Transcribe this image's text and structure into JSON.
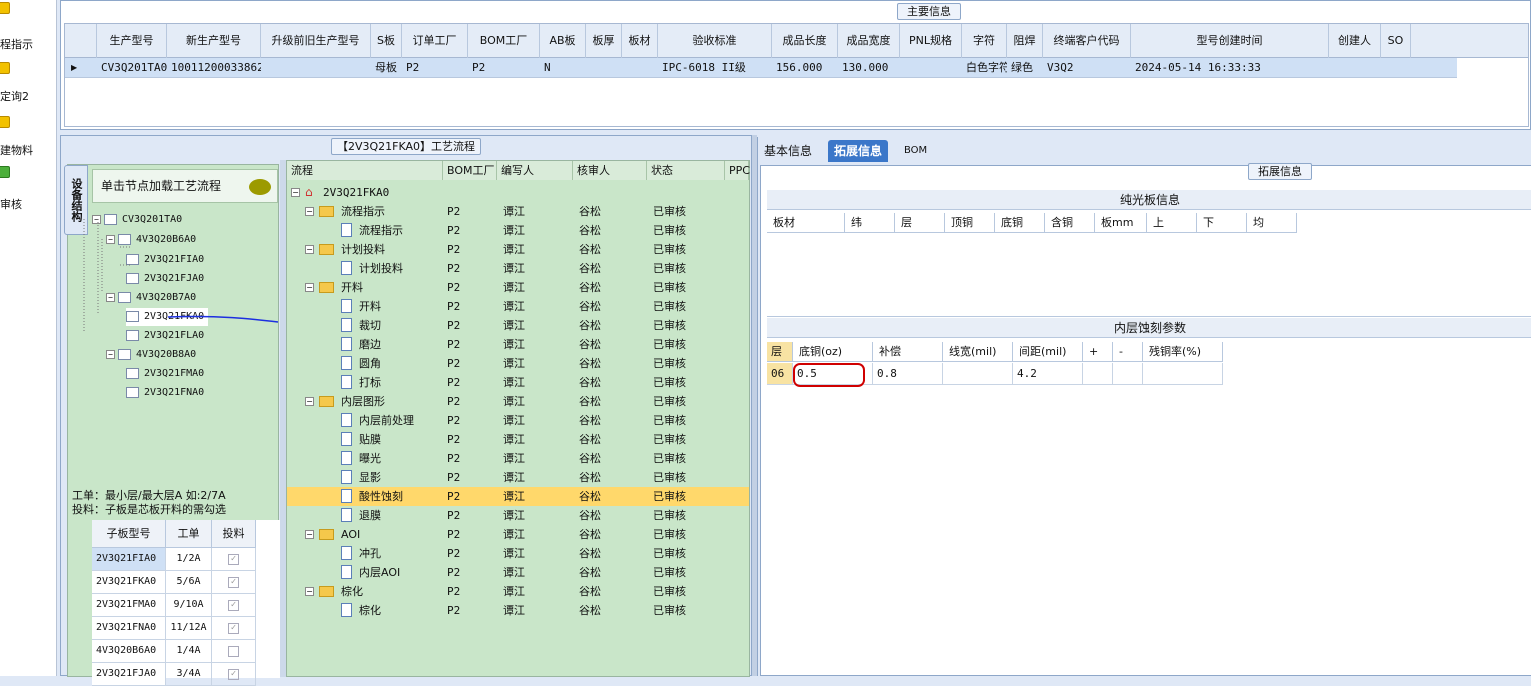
{
  "nav": {
    "items": [
      {
        "label": "程指示",
        "icon": "folder-icon"
      },
      {
        "label": "定询2",
        "icon": "folder-icon"
      },
      {
        "label": "建物料",
        "icon": "folder-icon"
      },
      {
        "label": "审核",
        "icon": "person-icon"
      }
    ]
  },
  "main_info": {
    "title": "主要信息",
    "columns": [
      "生产型号",
      "新生产型号",
      "升级前旧生产型号",
      "S板",
      "订单工厂",
      "BOM工厂",
      "AB板",
      "板厚",
      "板材",
      "验收标准",
      "成品长度",
      "成品宽度",
      "PNL规格",
      "字符",
      "阻焊",
      "终端客户代码",
      "型号创建时间",
      "创建人",
      "SO"
    ],
    "row": [
      "CV3Q201TA0",
      "10011200033862",
      "",
      "母板",
      "P2",
      "P2",
      "N",
      "",
      "",
      "IPC-6018 II级",
      "156.000",
      "130.000",
      "",
      "白色字符",
      "绿色",
      "V3Q2",
      "2024-05-14 16:33:33",
      "",
      ""
    ]
  },
  "process": {
    "title": "【2V3Q21FKA0】工艺流程",
    "side_tab": "设备结构",
    "load_hint": "单击节点加载工艺流程",
    "tree": [
      "CV3Q201TA0",
      "4V3Q20B6A0",
      "2V3Q21FIA0",
      "2V3Q21FJA0",
      "4V3Q20B7A0",
      "2V3Q21FKA0",
      "2V3Q21FLA0",
      "4V3Q20B8A0",
      "2V3Q21FMA0",
      "2V3Q21FNA0"
    ],
    "notes": [
      "工单：最小层/最大层A 如:2/7A",
      "投料：子板是芯板开料的需勾选"
    ],
    "sub_grid": {
      "headers": [
        "子板型号",
        "工单",
        "投料"
      ],
      "rows": [
        [
          "2V3Q21FIA0",
          "1/2A"
        ],
        [
          "2V3Q21FKA0",
          "5/6A"
        ],
        [
          "2V3Q21FMA0",
          "9/10A"
        ],
        [
          "2V3Q21FNA0",
          "11/12A"
        ],
        [
          "4V3Q20B6A0",
          "1/4A"
        ],
        [
          "2V3Q21FJA0",
          "3/4A"
        ]
      ]
    },
    "flow_headers": [
      "流程",
      "BOM工厂",
      "编写人",
      "核审人",
      "状态",
      "PPC"
    ],
    "flow_root": "2V3Q21FKA0",
    "flow_rows": [
      {
        "name": "流程指示",
        "type": "folder"
      },
      {
        "name": "流程指示",
        "type": "doc"
      },
      {
        "name": "计划投料",
        "type": "folder"
      },
      {
        "name": "计划投料",
        "type": "doc"
      },
      {
        "name": "开料",
        "type": "folder"
      },
      {
        "name": "开料",
        "type": "doc"
      },
      {
        "name": "裁切",
        "type": "doc"
      },
      {
        "name": "磨边",
        "type": "doc"
      },
      {
        "name": "圆角",
        "type": "doc"
      },
      {
        "name": "打标",
        "type": "doc"
      },
      {
        "name": "内层图形",
        "type": "folder"
      },
      {
        "name": "内层前处理",
        "type": "doc"
      },
      {
        "name": "贴膜",
        "type": "doc"
      },
      {
        "name": "曝光",
        "type": "doc"
      },
      {
        "name": "显影",
        "type": "doc"
      },
      {
        "name": "酸性蚀刻",
        "type": "doc",
        "selected": true
      },
      {
        "name": "退膜",
        "type": "doc"
      },
      {
        "name": "AOI",
        "type": "folder"
      },
      {
        "name": "冲孔",
        "type": "doc"
      },
      {
        "name": "内层AOI",
        "type": "doc"
      },
      {
        "name": "棕化",
        "type": "folder"
      },
      {
        "name": "棕化",
        "type": "doc"
      }
    ],
    "flow_values": {
      "factory": "P2",
      "writer": "谭江",
      "reviewer": "谷松",
      "status": "已审核"
    }
  },
  "right": {
    "tabs": [
      "基本信息",
      "拓展信息",
      "BOM"
    ],
    "active_tab": "拓展信息",
    "section_title": "拓展信息",
    "plain_board": {
      "title": "纯光板信息",
      "headers": [
        "板材",
        "纬",
        "层",
        "顶铜",
        "底铜",
        "含铜",
        "板mm",
        "上",
        "下",
        "均"
      ]
    },
    "inner_etch": {
      "title": "内层蚀刻参数",
      "headers": [
        "层",
        "底铜(oz)",
        "补偿",
        "线宽(mil)",
        "间距(mil)",
        "+",
        "-",
        "残铜率(%)"
      ],
      "row": [
        "06",
        "0.5",
        "0.8",
        "",
        "4.2",
        "",
        "",
        ""
      ]
    }
  },
  "colors": {
    "selected_row": "#ffd86b",
    "tree_bg": "#c9e6c9",
    "annotation_red": "#d00000",
    "annotation_blue": "#1c2fe0"
  }
}
